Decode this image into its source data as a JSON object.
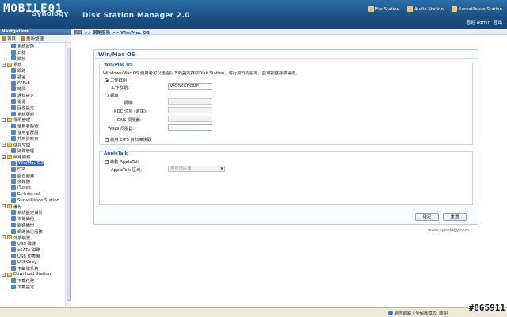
{
  "header": {
    "brand": "MOBILE01",
    "brand_sub": "Synology",
    "app_title": "Disk Station Manager 2.0",
    "links": [
      "File Station",
      "Audio Station",
      "Surveillance Station"
    ],
    "welcome": "歡迎 admin",
    "logout": "登出"
  },
  "sidebar": {
    "title": "Navigation",
    "toolbar": {
      "home": "首頁",
      "refresh": "重新整理"
    },
    "tree": [
      {
        "label": "系統狀態",
        "level": 1
      },
      {
        "label": "日誌",
        "level": 1
      },
      {
        "label": "關於",
        "level": 1
      },
      {
        "label": "系統",
        "level": 0
      },
      {
        "label": "網路",
        "level": 1
      },
      {
        "label": "語言",
        "level": 1
      },
      {
        "label": "PPPoE",
        "level": 1
      },
      {
        "label": "時間",
        "level": 1
      },
      {
        "label": "通知設定",
        "level": 1
      },
      {
        "label": "電源",
        "level": 1
      },
      {
        "label": "回復設定",
        "level": 1
      },
      {
        "label": "系統更新",
        "level": 1
      },
      {
        "label": "權限管理",
        "level": 0
      },
      {
        "label": "使用者帳號",
        "level": 1
      },
      {
        "label": "使用者群組",
        "level": 1
      },
      {
        "label": "共用資料夾",
        "level": 1
      },
      {
        "label": "儲存空間",
        "level": 0
      },
      {
        "label": "磁碟管理",
        "level": 1
      },
      {
        "label": "網路服務",
        "level": 0
      },
      {
        "label": "Win/Mac OS",
        "level": 1,
        "selected": true
      },
      {
        "label": "FTP",
        "level": 1
      },
      {
        "label": "網頁服務",
        "level": 1
      },
      {
        "label": "多媒體",
        "level": 1
      },
      {
        "label": "iTunes",
        "level": 1
      },
      {
        "label": "Ez-Internet",
        "level": 1
      },
      {
        "label": "Surveillance Station",
        "level": 1
      },
      {
        "label": "備份",
        "level": 0
      },
      {
        "label": "系統設定備份",
        "level": 1
      },
      {
        "label": "本地備份",
        "level": 1
      },
      {
        "label": "網路備份",
        "level": 1
      },
      {
        "label": "網路備份服務",
        "level": 1
      },
      {
        "label": "外接裝置",
        "level": 0
      },
      {
        "label": "USB 磁碟",
        "level": 1
      },
      {
        "label": "eSATA 磁碟",
        "level": 1
      },
      {
        "label": "USB 印表機",
        "level": 1
      },
      {
        "label": "USBCopy",
        "level": 1
      },
      {
        "label": "不斷電系統",
        "level": 1
      },
      {
        "label": "Download Station",
        "level": 0
      },
      {
        "label": "下載任務",
        "level": 1
      },
      {
        "label": "下載設定",
        "level": 1
      }
    ]
  },
  "main": {
    "breadcrumb": "首頁 >> 網路服務 >> Win/Mac OS",
    "panel_title": "Win/Mac OS",
    "section_win": {
      "legend": "Win/Mac OS",
      "description": "Windows/Mac OS 使用者可以透過以下的設定存取Disk Station，進行資料的設定，並可調整存取權限。",
      "workgroup_radio": "工作群組",
      "workgroup_label": "工作群組:",
      "workgroup_value": "WORKGROUP",
      "domain_radio": "網域",
      "domain_label": "網域:",
      "kdc_label": "KDC 位址 (選填):",
      "dns_label": "DNS 伺服器:",
      "wins_label": "WINS 伺服器:",
      "cifs_check": "啟用 CIFS 資料庫快取"
    },
    "section_apple": {
      "legend": "AppleTalk",
      "enable_check": "啟動 AppleTalk",
      "zone_label": "AppleTalk 區域:",
      "zone_value": "無可用區域"
    },
    "ok_button": "確定",
    "reset_button": "重置",
    "credit": "www.synology.com"
  },
  "statusbar": {
    "zone": "網際網路 | 受保護模式: 關閉"
  },
  "watermark": "#865911"
}
